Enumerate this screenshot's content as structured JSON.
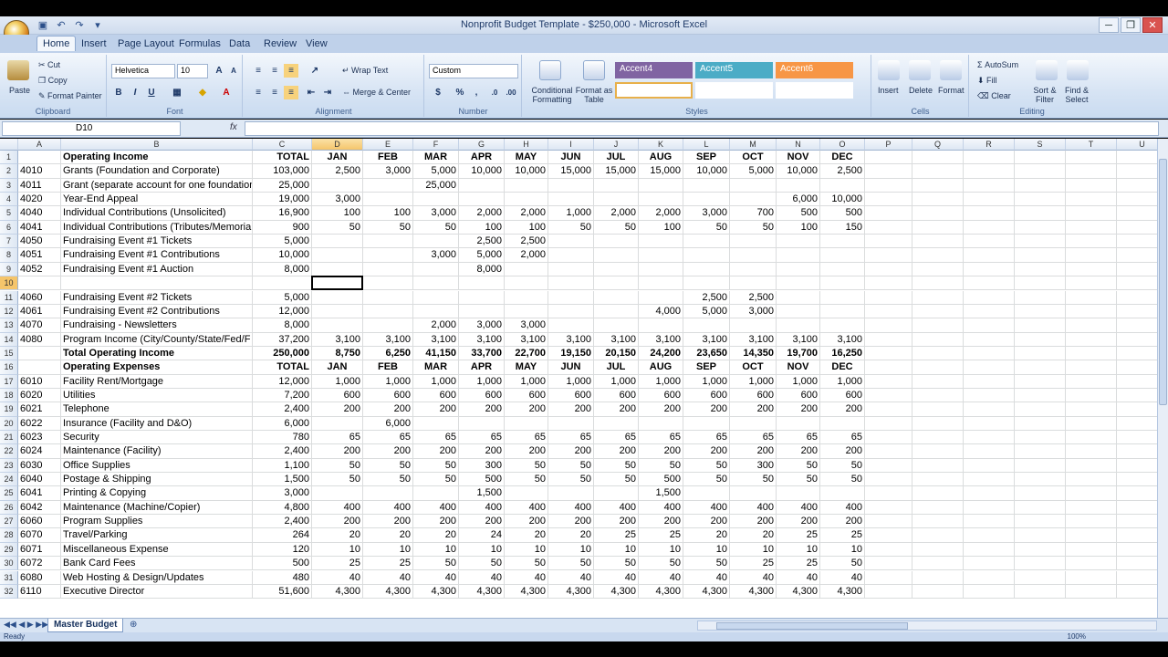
{
  "window": {
    "title": "Nonprofit Budget Template - $250,000 - Microsoft Excel",
    "minimize": "─",
    "restore": "❐",
    "close": "✕"
  },
  "tabs": [
    "Home",
    "Insert",
    "Page Layout",
    "Formulas",
    "Data",
    "Review",
    "View"
  ],
  "ribbon": {
    "clipboard": {
      "paste": "Paste",
      "cut": "Cut",
      "copy": "Copy",
      "format_painter": "Format Painter",
      "label": "Clipboard"
    },
    "font": {
      "name": "Helvetica",
      "size": "10",
      "label": "Font"
    },
    "alignment": {
      "wrap": "Wrap Text",
      "merge": "Merge & Center",
      "label": "Alignment"
    },
    "number": {
      "format": "Custom",
      "label": "Number"
    },
    "styles": {
      "conditional": "Conditional Formatting",
      "format_table": "Format as Table",
      "accent4": "Accent4",
      "accent5": "Accent5",
      "accent6": "Accent6",
      "label": "Styles"
    },
    "cells": {
      "insert": "Insert",
      "delete": "Delete",
      "format": "Format",
      "label": "Cells"
    },
    "editing": {
      "autosum": "AutoSum",
      "fill": "Fill",
      "clear": "Clear",
      "sort": "Sort & Filter",
      "find": "Find & Select",
      "label": "Editing"
    }
  },
  "formula_bar": {
    "name_box": "D10",
    "fx": "fx",
    "value": ""
  },
  "columns": [
    "A",
    "B",
    "C",
    "D",
    "E",
    "F",
    "G",
    "H",
    "I",
    "J",
    "K",
    "L",
    "M",
    "N",
    "O",
    "P",
    "Q",
    "R",
    "S",
    "T",
    "U"
  ],
  "rows": [
    {
      "n": "1",
      "a": "",
      "b": "Operating Income",
      "c": "TOTAL",
      "m": [
        "JAN",
        "FEB",
        "MAR",
        "APR",
        "MAY",
        "JUN",
        "JUL",
        "AUG",
        "SEP",
        "OCT",
        "NOV",
        "DEC"
      ],
      "style": "header"
    },
    {
      "n": "2",
      "a": "4010",
      "b": "Grants (Foundation and Corporate)",
      "c": "103,000",
      "m": [
        "2,500",
        "3,000",
        "5,000",
        "10,000",
        "10,000",
        "15,000",
        "15,000",
        "15,000",
        "10,000",
        "5,000",
        "10,000",
        "2,500"
      ]
    },
    {
      "n": "3",
      "a": "4011",
      "b": "Grant (separate account for one foundation",
      "c": "25,000",
      "m": [
        "",
        "",
        "25,000",
        "",
        "",
        "",
        "",
        "",
        "",
        "",
        "",
        ""
      ]
    },
    {
      "n": "4",
      "a": "4020",
      "b": "Year-End Appeal",
      "c": "19,000",
      "m": [
        "3,000",
        "",
        "",
        "",
        "",
        "",
        "",
        "",
        "",
        "",
        "6,000",
        "10,000"
      ]
    },
    {
      "n": "5",
      "a": "4040",
      "b": "Individual Contributions (Unsolicited)",
      "c": "16,900",
      "m": [
        "100",
        "100",
        "3,000",
        "2,000",
        "2,000",
        "1,000",
        "2,000",
        "2,000",
        "3,000",
        "700",
        "500",
        "500"
      ]
    },
    {
      "n": "6",
      "a": "4041",
      "b": "Individual Contributions (Tributes/Memorial",
      "c": "900",
      "m": [
        "50",
        "50",
        "50",
        "100",
        "100",
        "50",
        "50",
        "100",
        "50",
        "50",
        "100",
        "150"
      ]
    },
    {
      "n": "7",
      "a": "4050",
      "b": "Fundraising Event #1 Tickets",
      "c": "5,000",
      "m": [
        "",
        "",
        "",
        "2,500",
        "2,500",
        "",
        "",
        "",
        "",
        "",
        "",
        ""
      ]
    },
    {
      "n": "8",
      "a": "4051",
      "b": "Fundraising Event #1 Contributions",
      "c": "10,000",
      "m": [
        "",
        "",
        "3,000",
        "5,000",
        "2,000",
        "",
        "",
        "",
        "",
        "",
        "",
        ""
      ]
    },
    {
      "n": "9",
      "a": "4052",
      "b": "Fundraising Event #1 Auction",
      "c": "8,000",
      "m": [
        "",
        "",
        "",
        "8,000",
        "",
        "",
        "",
        "",
        "",
        "",
        "",
        ""
      ]
    },
    {
      "n": "10",
      "a": "",
      "b": "",
      "c": "",
      "m": [
        "",
        "",
        "",
        "",
        "",
        "",
        "",
        "",
        "",
        "",
        "",
        ""
      ]
    },
    {
      "n": "11",
      "a": "4060",
      "b": "Fundraising Event #2 Tickets",
      "c": "5,000",
      "m": [
        "",
        "",
        "",
        "",
        "",
        "",
        "",
        "",
        "2,500",
        "2,500",
        "",
        ""
      ]
    },
    {
      "n": "12",
      "a": "4061",
      "b": "Fundraising Event #2 Contributions",
      "c": "12,000",
      "m": [
        "",
        "",
        "",
        "",
        "",
        "",
        "",
        "4,000",
        "5,000",
        "3,000",
        "",
        ""
      ]
    },
    {
      "n": "13",
      "a": "4070",
      "b": "Fundraising - Newsletters",
      "c": "8,000",
      "m": [
        "",
        "",
        "2,000",
        "3,000",
        "3,000",
        "",
        "",
        "",
        "",
        "",
        "",
        ""
      ]
    },
    {
      "n": "14",
      "a": "4080",
      "b": "Program Income (City/County/State/Fed/F",
      "c": "37,200",
      "m": [
        "3,100",
        "3,100",
        "3,100",
        "3,100",
        "3,100",
        "3,100",
        "3,100",
        "3,100",
        "3,100",
        "3,100",
        "3,100",
        "3,100"
      ]
    },
    {
      "n": "15",
      "a": "",
      "b": "Total Operating Income",
      "c": "250,000",
      "m": [
        "8,750",
        "6,250",
        "41,150",
        "33,700",
        "22,700",
        "19,150",
        "20,150",
        "24,200",
        "23,650",
        "14,350",
        "19,700",
        "16,250"
      ],
      "style": "total"
    },
    {
      "n": "16",
      "a": "",
      "b": "Operating Expenses",
      "c": "TOTAL",
      "m": [
        "JAN",
        "FEB",
        "MAR",
        "APR",
        "MAY",
        "JUN",
        "JUL",
        "AUG",
        "SEP",
        "OCT",
        "NOV",
        "DEC"
      ],
      "style": "header"
    },
    {
      "n": "17",
      "a": "6010",
      "b": "Facility Rent/Mortgage",
      "c": "12,000",
      "m": [
        "1,000",
        "1,000",
        "1,000",
        "1,000",
        "1,000",
        "1,000",
        "1,000",
        "1,000",
        "1,000",
        "1,000",
        "1,000",
        "1,000"
      ]
    },
    {
      "n": "18",
      "a": "6020",
      "b": "Utilities",
      "c": "7,200",
      "m": [
        "600",
        "600",
        "600",
        "600",
        "600",
        "600",
        "600",
        "600",
        "600",
        "600",
        "600",
        "600"
      ]
    },
    {
      "n": "19",
      "a": "6021",
      "b": "Telephone",
      "c": "2,400",
      "m": [
        "200",
        "200",
        "200",
        "200",
        "200",
        "200",
        "200",
        "200",
        "200",
        "200",
        "200",
        "200"
      ]
    },
    {
      "n": "20",
      "a": "6022",
      "b": "Insurance (Facility and D&O)",
      "c": "6,000",
      "m": [
        "",
        "6,000",
        "",
        "",
        "",
        "",
        "",
        "",
        "",
        "",
        "",
        ""
      ]
    },
    {
      "n": "21",
      "a": "6023",
      "b": "Security",
      "c": "780",
      "m": [
        "65",
        "65",
        "65",
        "65",
        "65",
        "65",
        "65",
        "65",
        "65",
        "65",
        "65",
        "65"
      ]
    },
    {
      "n": "22",
      "a": "6024",
      "b": "Maintenance (Facility)",
      "c": "2,400",
      "m": [
        "200",
        "200",
        "200",
        "200",
        "200",
        "200",
        "200",
        "200",
        "200",
        "200",
        "200",
        "200"
      ]
    },
    {
      "n": "23",
      "a": "6030",
      "b": "Office Supplies",
      "c": "1,100",
      "m": [
        "50",
        "50",
        "50",
        "300",
        "50",
        "50",
        "50",
        "50",
        "50",
        "300",
        "50",
        "50"
      ]
    },
    {
      "n": "24",
      "a": "6040",
      "b": "Postage & Shipping",
      "c": "1,500",
      "m": [
        "50",
        "50",
        "50",
        "500",
        "50",
        "50",
        "50",
        "500",
        "50",
        "50",
        "50",
        "50"
      ]
    },
    {
      "n": "25",
      "a": "6041",
      "b": "Printing & Copying",
      "c": "3,000",
      "m": [
        "",
        "",
        "",
        "1,500",
        "",
        "",
        "",
        "1,500",
        "",
        "",
        "",
        ""
      ]
    },
    {
      "n": "26",
      "a": "6042",
      "b": "Maintenance (Machine/Copier)",
      "c": "4,800",
      "m": [
        "400",
        "400",
        "400",
        "400",
        "400",
        "400",
        "400",
        "400",
        "400",
        "400",
        "400",
        "400"
      ]
    },
    {
      "n": "27",
      "a": "6060",
      "b": "Program Supplies",
      "c": "2,400",
      "m": [
        "200",
        "200",
        "200",
        "200",
        "200",
        "200",
        "200",
        "200",
        "200",
        "200",
        "200",
        "200"
      ]
    },
    {
      "n": "28",
      "a": "6070",
      "b": "Travel/Parking",
      "c": "264",
      "m": [
        "20",
        "20",
        "20",
        "24",
        "20",
        "20",
        "25",
        "25",
        "20",
        "20",
        "25",
        "25"
      ]
    },
    {
      "n": "29",
      "a": "6071",
      "b": "Miscellaneous Expense",
      "c": "120",
      "m": [
        "10",
        "10",
        "10",
        "10",
        "10",
        "10",
        "10",
        "10",
        "10",
        "10",
        "10",
        "10"
      ]
    },
    {
      "n": "30",
      "a": "6072",
      "b": "Bank Card Fees",
      "c": "500",
      "m": [
        "25",
        "25",
        "50",
        "50",
        "50",
        "50",
        "50",
        "50",
        "50",
        "25",
        "25",
        "50"
      ]
    },
    {
      "n": "31",
      "a": "6080",
      "b": "Web Hosting & Design/Updates",
      "c": "480",
      "m": [
        "40",
        "40",
        "40",
        "40",
        "40",
        "40",
        "40",
        "40",
        "40",
        "40",
        "40",
        "40"
      ]
    },
    {
      "n": "32",
      "a": "6110",
      "b": "Executive Director",
      "c": "51,600",
      "m": [
        "4,300",
        "4,300",
        "4,300",
        "4,300",
        "4,300",
        "4,300",
        "4,300",
        "4,300",
        "4,300",
        "4,300",
        "4,300",
        "4,300"
      ]
    }
  ],
  "sheet_tab": "Master Budget",
  "status": "Ready",
  "zoom": "100%",
  "colors": {
    "accent4": "#8064a2",
    "accent5": "#4bacc6",
    "accent6": "#f79646",
    "selection": "#f5c56b"
  }
}
